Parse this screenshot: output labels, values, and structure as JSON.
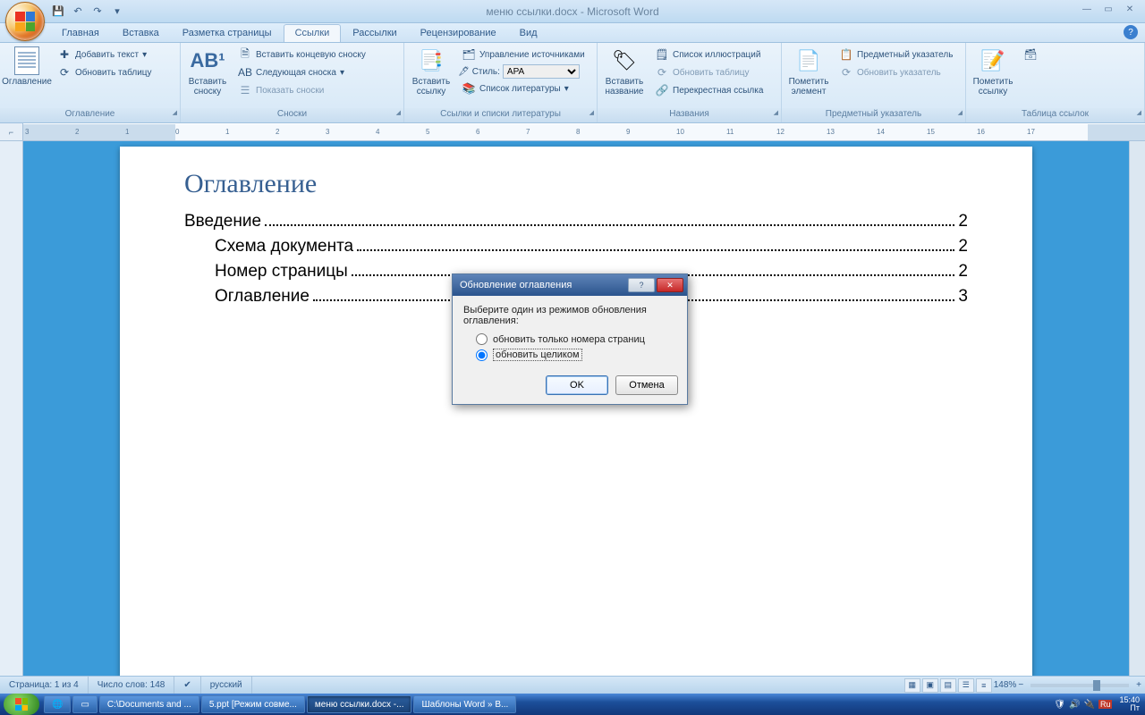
{
  "titlebar": {
    "title": "меню ссылки.docx - Microsoft Word"
  },
  "qat": {
    "save": "💾",
    "undo": "↶",
    "redo": "↷",
    "custom": "▾"
  },
  "tabs": {
    "items": [
      "Главная",
      "Вставка",
      "Разметка страницы",
      "Ссылки",
      "Рассылки",
      "Рецензирование",
      "Вид"
    ],
    "active": 3
  },
  "ribbon": {
    "groups": {
      "toc": {
        "label": "Оглавление",
        "big": "Оглавление",
        "add_text": "Добавить текст",
        "update": "Обновить таблицу"
      },
      "footnotes": {
        "label": "Сноски",
        "big": "Вставить сноску",
        "ab": "AB¹",
        "endnote": "Вставить концевую сноску",
        "next": "Следующая сноска",
        "show": "Показать сноски"
      },
      "citations": {
        "label": "Ссылки и списки литературы",
        "big": "Вставить ссылку",
        "manage": "Управление источниками",
        "style_label": "Стиль:",
        "style_value": "APA",
        "biblio": "Список литературы"
      },
      "captions": {
        "label": "Названия",
        "big": "Вставить название",
        "figlist": "Список иллюстраций",
        "update": "Обновить таблицу",
        "crossref": "Перекрестная ссылка"
      },
      "index": {
        "label": "Предметный указатель",
        "big": "Пометить элемент",
        "insert": "Предметный указатель",
        "update": "Обновить указатель"
      },
      "toa": {
        "label": "Таблица ссылок",
        "big": "Пометить ссылку"
      }
    }
  },
  "document": {
    "title": "Оглавление",
    "toc": [
      {
        "text": "Введение",
        "page": "2",
        "indent": false
      },
      {
        "text": "Схема документа",
        "page": "2",
        "indent": true
      },
      {
        "text": "Номер страницы",
        "page": "2",
        "indent": true
      },
      {
        "text": "Оглавление",
        "page": "3",
        "indent": true
      }
    ]
  },
  "dialog": {
    "title": "Обновление оглавления",
    "prompt": "Выберите один из режимов обновления оглавления:",
    "opt1": "обновить только номера страниц",
    "opt2": "обновить целиком",
    "ok": "OK",
    "cancel": "Отмена"
  },
  "statusbar": {
    "page": "Страница: 1 из 4",
    "words": "Число слов: 148",
    "lang": "русский",
    "zoom": "148%"
  },
  "taskbar": {
    "items": [
      {
        "label": "C:\\Documents and ...",
        "active": false
      },
      {
        "label": "5.ppt [Режим совме...",
        "active": false
      },
      {
        "label": "меню ссылки.docx -...",
        "active": true
      },
      {
        "label": "Шаблоны Word » B...",
        "active": false
      }
    ],
    "clock": {
      "time": "15:40",
      "day": "Пт"
    }
  }
}
